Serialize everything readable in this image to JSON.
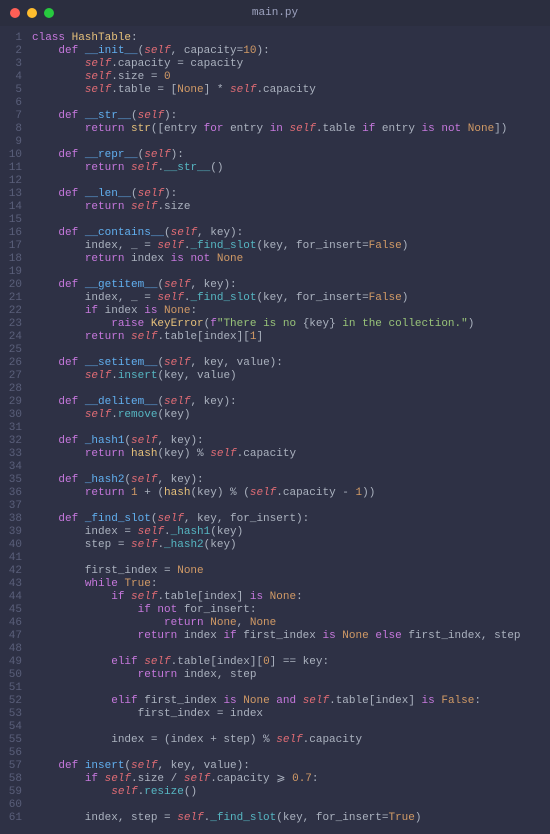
{
  "window": {
    "filename": "main.py"
  },
  "code": {
    "lines": [
      [
        [
          "kw",
          "class "
        ],
        [
          "cls",
          "HashTable"
        ],
        [
          "pn",
          ":"
        ]
      ],
      [
        [
          "pn",
          "    "
        ],
        [
          "kw",
          "def "
        ],
        [
          "def",
          "__init__"
        ],
        [
          "pn",
          "("
        ],
        [
          "self",
          "self"
        ],
        [
          "pn",
          ", capacity="
        ],
        [
          "num",
          "10"
        ],
        [
          "pn",
          "):"
        ]
      ],
      [
        [
          "pn",
          "        "
        ],
        [
          "self",
          "self"
        ],
        [
          "pn",
          ".capacity = capacity"
        ]
      ],
      [
        [
          "pn",
          "        "
        ],
        [
          "self",
          "self"
        ],
        [
          "pn",
          ".size = "
        ],
        [
          "num",
          "0"
        ]
      ],
      [
        [
          "pn",
          "        "
        ],
        [
          "self",
          "self"
        ],
        [
          "pn",
          ".table = ["
        ],
        [
          "cn",
          "None"
        ],
        [
          "pn",
          "] * "
        ],
        [
          "self",
          "self"
        ],
        [
          "pn",
          ".capacity"
        ]
      ],
      [],
      [
        [
          "pn",
          "    "
        ],
        [
          "kw",
          "def "
        ],
        [
          "def",
          "__str__"
        ],
        [
          "pn",
          "("
        ],
        [
          "self",
          "self"
        ],
        [
          "pn",
          "):"
        ]
      ],
      [
        [
          "pn",
          "        "
        ],
        [
          "kw",
          "return "
        ],
        [
          "bi",
          "str"
        ],
        [
          "pn",
          "([entry "
        ],
        [
          "kw",
          "for"
        ],
        [
          "pn",
          " entry "
        ],
        [
          "kw",
          "in"
        ],
        [
          "pn",
          " "
        ],
        [
          "self",
          "self"
        ],
        [
          "pn",
          ".table "
        ],
        [
          "kw",
          "if"
        ],
        [
          "pn",
          " entry "
        ],
        [
          "kw",
          "is not"
        ],
        [
          "pn",
          " "
        ],
        [
          "cn",
          "None"
        ],
        [
          "pn",
          "])"
        ]
      ],
      [],
      [
        [
          "pn",
          "    "
        ],
        [
          "kw",
          "def "
        ],
        [
          "def",
          "__repr__"
        ],
        [
          "pn",
          "("
        ],
        [
          "self",
          "self"
        ],
        [
          "pn",
          "):"
        ]
      ],
      [
        [
          "pn",
          "        "
        ],
        [
          "kw",
          "return "
        ],
        [
          "self",
          "self"
        ],
        [
          "pn",
          "."
        ],
        [
          "fn",
          "__str__"
        ],
        [
          "pn",
          "()"
        ]
      ],
      [],
      [
        [
          "pn",
          "    "
        ],
        [
          "kw",
          "def "
        ],
        [
          "def",
          "__len__"
        ],
        [
          "pn",
          "("
        ],
        [
          "self",
          "self"
        ],
        [
          "pn",
          "):"
        ]
      ],
      [
        [
          "pn",
          "        "
        ],
        [
          "kw",
          "return "
        ],
        [
          "self",
          "self"
        ],
        [
          "pn",
          ".size"
        ]
      ],
      [],
      [
        [
          "pn",
          "    "
        ],
        [
          "kw",
          "def "
        ],
        [
          "def",
          "__contains__"
        ],
        [
          "pn",
          "("
        ],
        [
          "self",
          "self"
        ],
        [
          "pn",
          ", key):"
        ]
      ],
      [
        [
          "pn",
          "        index, _ = "
        ],
        [
          "self",
          "self"
        ],
        [
          "pn",
          "."
        ],
        [
          "fn",
          "_find_slot"
        ],
        [
          "pn",
          "(key, for_insert="
        ],
        [
          "cn",
          "False"
        ],
        [
          "pn",
          ")"
        ]
      ],
      [
        [
          "pn",
          "        "
        ],
        [
          "kw",
          "return "
        ],
        [
          "pn",
          "index "
        ],
        [
          "kw",
          "is not"
        ],
        [
          "pn",
          " "
        ],
        [
          "cn",
          "None"
        ]
      ],
      [],
      [
        [
          "pn",
          "    "
        ],
        [
          "kw",
          "def "
        ],
        [
          "def",
          "__getitem__"
        ],
        [
          "pn",
          "("
        ],
        [
          "self",
          "self"
        ],
        [
          "pn",
          ", key):"
        ]
      ],
      [
        [
          "pn",
          "        index, _ = "
        ],
        [
          "self",
          "self"
        ],
        [
          "pn",
          "."
        ],
        [
          "fn",
          "_find_slot"
        ],
        [
          "pn",
          "(key, for_insert="
        ],
        [
          "cn",
          "False"
        ],
        [
          "pn",
          ")"
        ]
      ],
      [
        [
          "pn",
          "        "
        ],
        [
          "kw",
          "if"
        ],
        [
          "pn",
          " index "
        ],
        [
          "kw",
          "is"
        ],
        [
          "pn",
          " "
        ],
        [
          "cn",
          "None"
        ],
        [
          "pn",
          ":"
        ]
      ],
      [
        [
          "pn",
          "            "
        ],
        [
          "kw",
          "raise "
        ],
        [
          "bi",
          "KeyError"
        ],
        [
          "pn",
          "("
        ],
        [
          "kw",
          "f"
        ],
        [
          "str",
          "\"There is no "
        ],
        [
          "pn",
          "{key}"
        ],
        [
          "str",
          " in the collection.\""
        ],
        [
          "pn",
          ")"
        ]
      ],
      [
        [
          "pn",
          "        "
        ],
        [
          "kw",
          "return "
        ],
        [
          "self",
          "self"
        ],
        [
          "pn",
          ".table[index]["
        ],
        [
          "num",
          "1"
        ],
        [
          "pn",
          "]"
        ]
      ],
      [],
      [
        [
          "pn",
          "    "
        ],
        [
          "kw",
          "def "
        ],
        [
          "def",
          "__setitem__"
        ],
        [
          "pn",
          "("
        ],
        [
          "self",
          "self"
        ],
        [
          "pn",
          ", key, value):"
        ]
      ],
      [
        [
          "pn",
          "        "
        ],
        [
          "self",
          "self"
        ],
        [
          "pn",
          "."
        ],
        [
          "fn",
          "insert"
        ],
        [
          "pn",
          "(key, value)"
        ]
      ],
      [],
      [
        [
          "pn",
          "    "
        ],
        [
          "kw",
          "def "
        ],
        [
          "def",
          "__delitem__"
        ],
        [
          "pn",
          "("
        ],
        [
          "self",
          "self"
        ],
        [
          "pn",
          ", key):"
        ]
      ],
      [
        [
          "pn",
          "        "
        ],
        [
          "self",
          "self"
        ],
        [
          "pn",
          "."
        ],
        [
          "fn",
          "remove"
        ],
        [
          "pn",
          "(key)"
        ]
      ],
      [],
      [
        [
          "pn",
          "    "
        ],
        [
          "kw",
          "def "
        ],
        [
          "def",
          "_hash1"
        ],
        [
          "pn",
          "("
        ],
        [
          "self",
          "self"
        ],
        [
          "pn",
          ", key):"
        ]
      ],
      [
        [
          "pn",
          "        "
        ],
        [
          "kw",
          "return "
        ],
        [
          "bi",
          "hash"
        ],
        [
          "pn",
          "(key) % "
        ],
        [
          "self",
          "self"
        ],
        [
          "pn",
          ".capacity"
        ]
      ],
      [],
      [
        [
          "pn",
          "    "
        ],
        [
          "kw",
          "def "
        ],
        [
          "def",
          "_hash2"
        ],
        [
          "pn",
          "("
        ],
        [
          "self",
          "self"
        ],
        [
          "pn",
          ", key):"
        ]
      ],
      [
        [
          "pn",
          "        "
        ],
        [
          "kw",
          "return "
        ],
        [
          "num",
          "1"
        ],
        [
          "pn",
          " + ("
        ],
        [
          "bi",
          "hash"
        ],
        [
          "pn",
          "(key) % ("
        ],
        [
          "self",
          "self"
        ],
        [
          "pn",
          ".capacity - "
        ],
        [
          "num",
          "1"
        ],
        [
          "pn",
          "))"
        ]
      ],
      [],
      [
        [
          "pn",
          "    "
        ],
        [
          "kw",
          "def "
        ],
        [
          "def",
          "_find_slot"
        ],
        [
          "pn",
          "("
        ],
        [
          "self",
          "self"
        ],
        [
          "pn",
          ", key, for_insert):"
        ]
      ],
      [
        [
          "pn",
          "        index = "
        ],
        [
          "self",
          "self"
        ],
        [
          "pn",
          "."
        ],
        [
          "fn",
          "_hash1"
        ],
        [
          "pn",
          "(key)"
        ]
      ],
      [
        [
          "pn",
          "        step = "
        ],
        [
          "self",
          "self"
        ],
        [
          "pn",
          "."
        ],
        [
          "fn",
          "_hash2"
        ],
        [
          "pn",
          "(key)"
        ]
      ],
      [],
      [
        [
          "pn",
          "        first_index = "
        ],
        [
          "cn",
          "None"
        ]
      ],
      [
        [
          "pn",
          "        "
        ],
        [
          "kw",
          "while"
        ],
        [
          "pn",
          " "
        ],
        [
          "cn",
          "True"
        ],
        [
          "pn",
          ":"
        ]
      ],
      [
        [
          "pn",
          "            "
        ],
        [
          "kw",
          "if"
        ],
        [
          "pn",
          " "
        ],
        [
          "self",
          "self"
        ],
        [
          "pn",
          ".table[index] "
        ],
        [
          "kw",
          "is"
        ],
        [
          "pn",
          " "
        ],
        [
          "cn",
          "None"
        ],
        [
          "pn",
          ":"
        ]
      ],
      [
        [
          "pn",
          "                "
        ],
        [
          "kw",
          "if not"
        ],
        [
          "pn",
          " for_insert:"
        ]
      ],
      [
        [
          "pn",
          "                    "
        ],
        [
          "kw",
          "return "
        ],
        [
          "cn",
          "None"
        ],
        [
          "pn",
          ", "
        ],
        [
          "cn",
          "None"
        ]
      ],
      [
        [
          "pn",
          "                "
        ],
        [
          "kw",
          "return "
        ],
        [
          "pn",
          "index "
        ],
        [
          "kw",
          "if"
        ],
        [
          "pn",
          " first_index "
        ],
        [
          "kw",
          "is"
        ],
        [
          "pn",
          " "
        ],
        [
          "cn",
          "None"
        ],
        [
          "pn",
          " "
        ],
        [
          "kw",
          "else"
        ],
        [
          "pn",
          " first_index, step"
        ]
      ],
      [],
      [
        [
          "pn",
          "            "
        ],
        [
          "kw",
          "elif"
        ],
        [
          "pn",
          " "
        ],
        [
          "self",
          "self"
        ],
        [
          "pn",
          ".table[index]["
        ],
        [
          "num",
          "0"
        ],
        [
          "pn",
          "] == key:"
        ]
      ],
      [
        [
          "pn",
          "                "
        ],
        [
          "kw",
          "return "
        ],
        [
          "pn",
          "index, step"
        ]
      ],
      [],
      [
        [
          "pn",
          "            "
        ],
        [
          "kw",
          "elif"
        ],
        [
          "pn",
          " first_index "
        ],
        [
          "kw",
          "is"
        ],
        [
          "pn",
          " "
        ],
        [
          "cn",
          "None"
        ],
        [
          "pn",
          " "
        ],
        [
          "kw",
          "and"
        ],
        [
          "pn",
          " "
        ],
        [
          "self",
          "self"
        ],
        [
          "pn",
          ".table[index] "
        ],
        [
          "kw",
          "is"
        ],
        [
          "pn",
          " "
        ],
        [
          "cn",
          "False"
        ],
        [
          "pn",
          ":"
        ]
      ],
      [
        [
          "pn",
          "                first_index = index"
        ]
      ],
      [],
      [
        [
          "pn",
          "            index = (index + step) % "
        ],
        [
          "self",
          "self"
        ],
        [
          "pn",
          ".capacity"
        ]
      ],
      [],
      [
        [
          "pn",
          "    "
        ],
        [
          "kw",
          "def "
        ],
        [
          "def",
          "insert"
        ],
        [
          "pn",
          "("
        ],
        [
          "self",
          "self"
        ],
        [
          "pn",
          ", key, value):"
        ]
      ],
      [
        [
          "pn",
          "        "
        ],
        [
          "kw",
          "if"
        ],
        [
          "pn",
          " "
        ],
        [
          "self",
          "self"
        ],
        [
          "pn",
          ".size / "
        ],
        [
          "self",
          "self"
        ],
        [
          "pn",
          ".capacity ⩾ "
        ],
        [
          "num",
          "0.7"
        ],
        [
          "pn",
          ":"
        ]
      ],
      [
        [
          "pn",
          "            "
        ],
        [
          "self",
          "self"
        ],
        [
          "pn",
          "."
        ],
        [
          "fn",
          "resize"
        ],
        [
          "pn",
          "()"
        ]
      ],
      [],
      [
        [
          "pn",
          "        index, step = "
        ],
        [
          "self",
          "self"
        ],
        [
          "pn",
          "."
        ],
        [
          "fn",
          "_find_slot"
        ],
        [
          "pn",
          "(key, for_insert="
        ],
        [
          "cn",
          "True"
        ],
        [
          "pn",
          ")"
        ]
      ]
    ]
  }
}
